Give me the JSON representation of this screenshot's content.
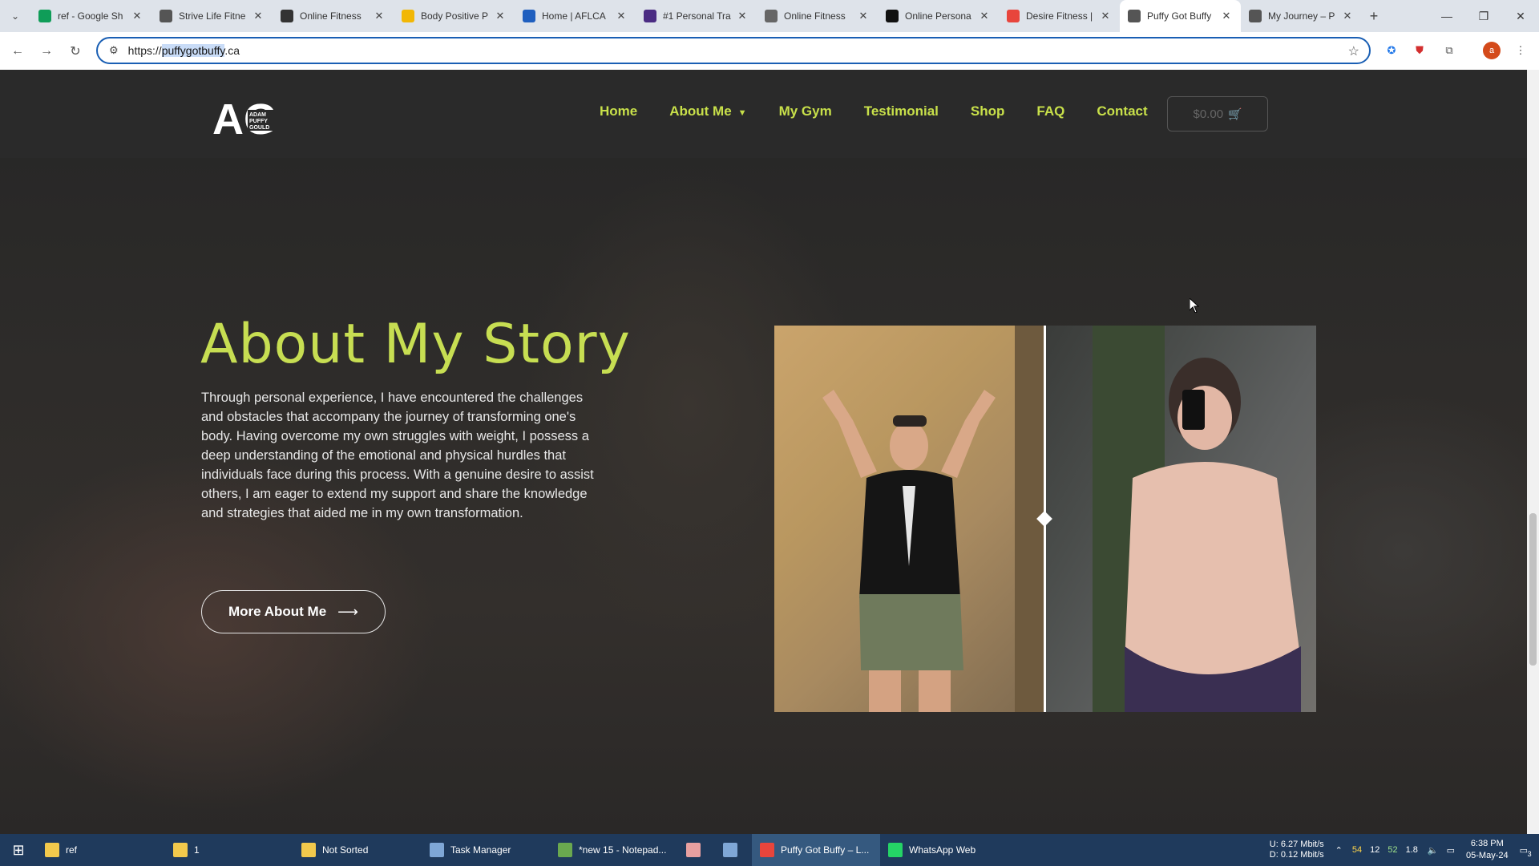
{
  "browser": {
    "tabs": [
      {
        "title": "ref - Google Sh",
        "icon": "sheets-icon",
        "color": "#0f9d58"
      },
      {
        "title": "Strive Life Fitne",
        "icon": "strive-icon",
        "color": "#555555"
      },
      {
        "title": "Online Fitness",
        "icon": "check-icon",
        "color": "#333333"
      },
      {
        "title": "Body Positive P",
        "icon": "body-icon",
        "color": "#f2b705"
      },
      {
        "title": "Home | AFLCA",
        "icon": "aflca-icon",
        "color": "#1f5fbf"
      },
      {
        "title": "#1 Personal Tra",
        "icon": "trainer-icon",
        "color": "#4b2c83"
      },
      {
        "title": "Online Fitness",
        "icon": "clock-icon",
        "color": "#666666"
      },
      {
        "title": "Online Persona",
        "icon": "persona-icon",
        "color": "#111111"
      },
      {
        "title": "Desire Fitness |",
        "icon": "desire-icon",
        "color": "#e8453c"
      },
      {
        "title": "Puffy Got Buffy",
        "icon": "puffy-icon",
        "color": "#555555"
      },
      {
        "title": "My Journey – P",
        "icon": "journey-icon",
        "color": "#555555"
      }
    ],
    "url_prefix": "https://",
    "url_selected": "puffygotbuffy",
    "url_suffix": ".ca"
  },
  "site": {
    "logo_text": "AG",
    "logo_sub": "ADAM PUFFY GOULD",
    "nav": [
      "Home",
      "About Me",
      "My Gym",
      "Testimonial",
      "Shop",
      "FAQ",
      "Contact"
    ],
    "cart_total": "$0.00"
  },
  "about": {
    "title": "About My Story",
    "body": "Through personal experience, I have encountered the challenges and obstacles that accompany the journey of transforming one's body. Having overcome my own struggles with weight, I possess a deep understanding of the emotional and physical hurdles that individuals face during this process. With a genuine desire to assist others, I am eager to extend my support and share the knowledge and strategies that aided me in my own transformation.",
    "button": "More About Me"
  },
  "taskbar": {
    "items": [
      {
        "label": "ref",
        "color": "#f2c94c"
      },
      {
        "label": "1",
        "color": "#f2c94c"
      },
      {
        "label": "Not Sorted",
        "color": "#f2c94c"
      },
      {
        "label": "Task Manager",
        "color": "#7fa7d6"
      },
      {
        "label": "*new 15 - Notepad...",
        "color": "#6aa84f"
      },
      {
        "label": "",
        "color": "#e8a0a0"
      },
      {
        "label": "",
        "color": "#7fa7d6"
      },
      {
        "label": "Puffy Got Buffy – L...",
        "color": "#e8453c"
      },
      {
        "label": "WhatsApp Web",
        "color": "#25d366"
      }
    ],
    "net_up": "U:   6.27 Mbit/s",
    "net_down": "D:   0.12 Mbit/s",
    "tray_values": [
      "54",
      "12",
      "52",
      "1.8"
    ],
    "time": "6:38 PM",
    "date": "05-May-24",
    "notif_count": "3"
  }
}
